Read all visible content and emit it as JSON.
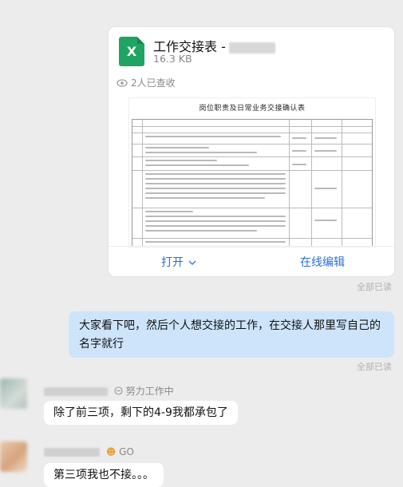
{
  "file_card": {
    "icon_letter": "X",
    "file_name": "工作交接表 -",
    "file_size": "16.3 KB",
    "read_count": "2人已查收",
    "preview_title": "岗位职责及日常业务交接确认表",
    "open_label": "打开",
    "online_edit_label": "在线编辑",
    "colors": {
      "excel_green": "#1fa463",
      "action_blue": "#2a6fd6"
    }
  },
  "read_status_1": "全部已读",
  "outgoing_message": {
    "line1": "大家看下吧，然后个人想交接的工作，在交接人那里写自己的",
    "line2": "名字就行",
    "bubble_color": "#cde4fb"
  },
  "read_status_2": "全部已读",
  "message_1": {
    "status": "努力工作中",
    "text": "除了前三项，剩下的4-9我都承包了"
  },
  "message_2": {
    "status": "GO",
    "text": "第三项我也不接。。。"
  }
}
